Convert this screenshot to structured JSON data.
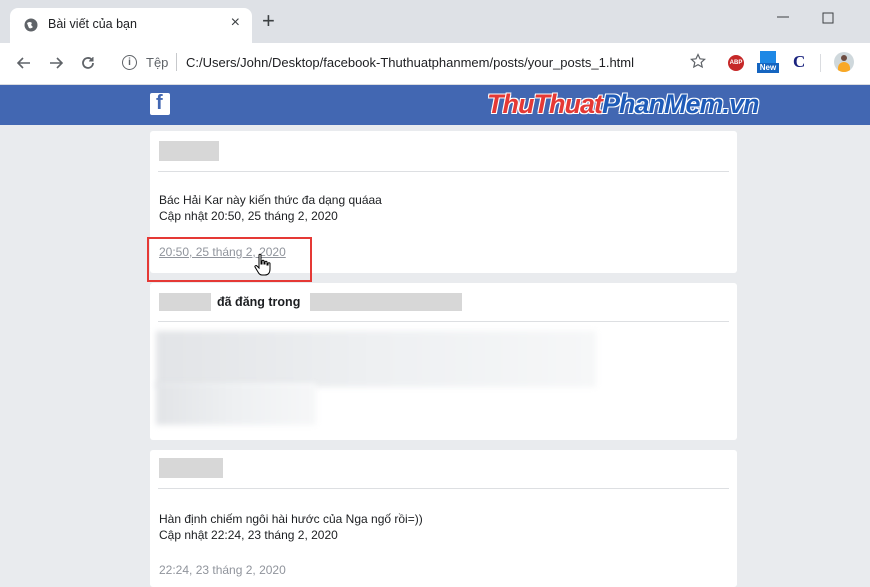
{
  "browser": {
    "tab_title": "Bài viết của bạn",
    "tab_close": "×",
    "new_tab": "+",
    "scheme_label": "Tệp",
    "url": "C:/Users/John/Desktop/facebook-Thuthuatphanmem/posts/your_posts_1.html",
    "extensions": [
      "abp-icon",
      "new-icon",
      "c-icon",
      "profile-avatar"
    ],
    "abp_label": "ABP",
    "new_label": "New",
    "c_label": "C"
  },
  "header": {
    "fb_logo": "f",
    "brand_part1": "ThuThuat",
    "brand_part2": "PhanMem",
    "brand_part3": ".vn",
    "color": "#4267b2"
  },
  "posts": [
    {
      "text": "Bác Hải Kar này kiến thức đa dạng quáaa",
      "updated": "Cập nhật 20:50, 25 tháng 2, 2020",
      "timestamp": "20:50, 25 tháng 2, 2020"
    },
    {
      "action": "đã đăng trong"
    },
    {
      "text": "Hàn định chiếm ngôi hài hước của Nga ngố rồi=))",
      "updated": "Cập nhật 22:24, 23 tháng 2, 2020",
      "timestamp": "22:24, 23 tháng 2, 2020"
    }
  ]
}
